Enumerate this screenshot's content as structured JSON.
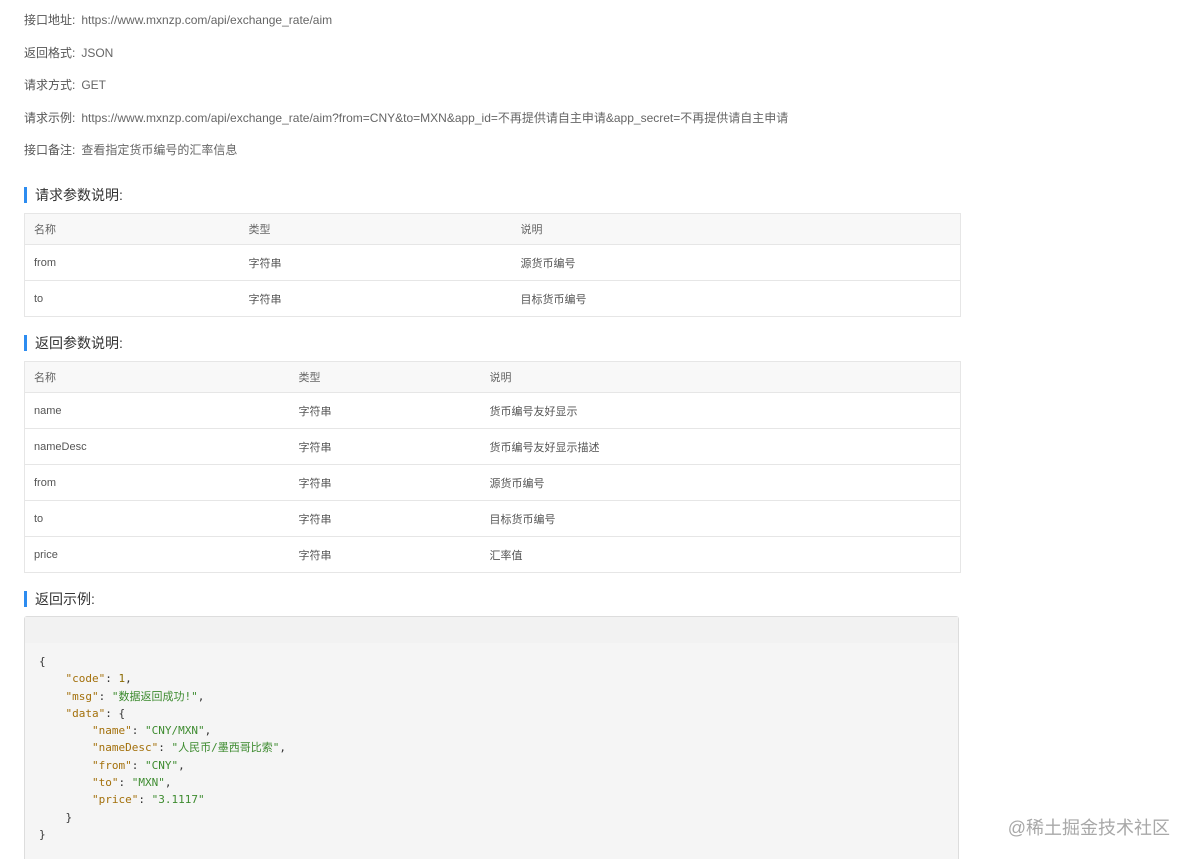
{
  "info": [
    {
      "label": "接口地址:",
      "value": "https://www.mxnzp.com/api/exchange_rate/aim"
    },
    {
      "label": "返回格式:",
      "value": "JSON"
    },
    {
      "label": "请求方式:",
      "value": "GET"
    },
    {
      "label": "请求示例:",
      "value": "https://www.mxnzp.com/api/exchange_rate/aim?from=CNY&to=MXN&app_id=不再提供请自主申请&app_secret=不再提供请自主申请"
    },
    {
      "label": "接口备注:",
      "value": "查看指定货币编号的汇率信息"
    }
  ],
  "request_params": {
    "title": "请求参数说明:",
    "headers": [
      "名称",
      "类型",
      "说明"
    ],
    "rows": [
      [
        "from",
        "字符串",
        "源货币编号"
      ],
      [
        "to",
        "字符串",
        "目标货币编号"
      ]
    ]
  },
  "response_params": {
    "title": "返回参数说明:",
    "headers": [
      "名称",
      "类型",
      "说明"
    ],
    "rows": [
      [
        "name",
        "字符串",
        "货币编号友好显示"
      ],
      [
        "nameDesc",
        "字符串",
        "货币编号友好显示描述"
      ],
      [
        "from",
        "字符串",
        "源货币编号"
      ],
      [
        "to",
        "字符串",
        "目标货币编号"
      ],
      [
        "price",
        "字符串",
        "汇率值"
      ]
    ]
  },
  "example": {
    "title": "返回示例:",
    "code_lines": [
      "{",
      "    \"code\": 1,",
      "    \"msg\": \"数据返回成功!\",",
      "    \"data\": {",
      "        \"name\": \"CNY/MXN\",",
      "        \"nameDesc\": \"人民币/墨西哥比索\",",
      "        \"from\": \"CNY\",",
      "        \"to\": \"MXN\",",
      "        \"price\": \"3.1117\"",
      "    }",
      "}"
    ]
  },
  "watermark": "@稀土掘金技术社区",
  "colors": {
    "accent": "#2d8cf0",
    "json_key": "#a3700b",
    "json_string": "#3d8b2f"
  }
}
